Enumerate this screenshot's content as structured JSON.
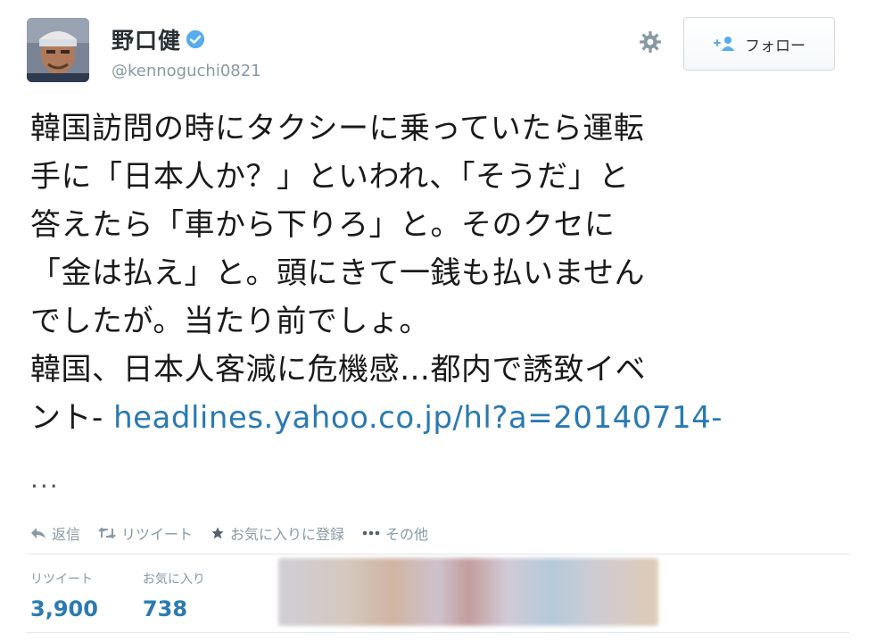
{
  "user": {
    "display_name": "野口健",
    "handle": "@kennoguchi0821",
    "verified": true
  },
  "header": {
    "settings_icon": "gear-icon",
    "follow_label": "フォロー",
    "follow_icon": "add-user-icon"
  },
  "tweet": {
    "lines": [
      "韓国訪問の時にタクシーに乗っていたら運転",
      "手に「日本人か？」といわれ、「そうだ」と",
      "答えたら「車から下りろ」と。そのクセに",
      "「金は払え」と。頭にきて一銭も払いません",
      "でしたが。当たり前でしょ。",
      "韓国、日本人客減に危機感…都内で誘致イベ"
    ],
    "last_line_prefix": "ント- ",
    "link_text": "headlines.yahoo.co.jp/hl?a=20140714-",
    "link_continuation": "..."
  },
  "actions": {
    "reply": "返信",
    "retweet": "リツイート",
    "favorite": "お気に入りに登録",
    "more": "その他"
  },
  "stats": {
    "retweets_label": "リツイート",
    "retweets_value": "3,900",
    "favorites_label": "お気に入り",
    "favorites_value": "738"
  },
  "colors": {
    "link": "#2a7ab0",
    "muted": "#8899a6",
    "verified": "#55acee"
  }
}
